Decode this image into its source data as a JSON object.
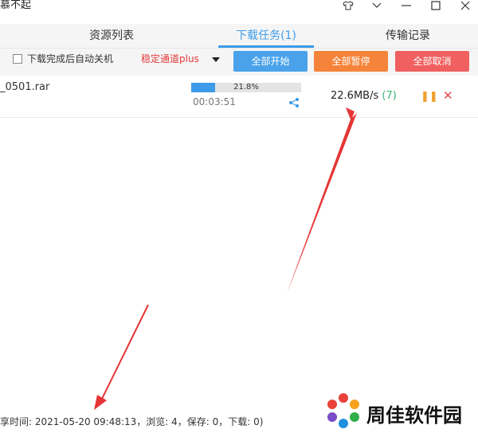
{
  "window": {
    "title": "慕不起"
  },
  "tabs": [
    {
      "label": "资源列表"
    },
    {
      "label": "下载任务(1)"
    },
    {
      "label": "传输记录"
    }
  ],
  "toolbar": {
    "auto_shutdown_label": "下载完成后自动关机",
    "auto_shutdown_checked": false,
    "channel_selected": "稳定通道plus",
    "start_all": "全部开始",
    "pause_all": "全部暂停",
    "cancel_all": "全部取消",
    "colors": {
      "start": "#4aa3ea",
      "pause": "#f5843a",
      "cancel": "#f06060"
    }
  },
  "task": {
    "filename": "_0501.rar",
    "progress_percent": 21.8,
    "progress_text": "21.8%",
    "elapsed": "00:03:51",
    "speed": "22.6MB/s",
    "connections": "(7)"
  },
  "footer": {
    "text": "享时间: 2021-05-20 09:48:13，浏览: 4，保存: 0，下载: 0)"
  },
  "watermark": {
    "text": "周佳软件园"
  }
}
